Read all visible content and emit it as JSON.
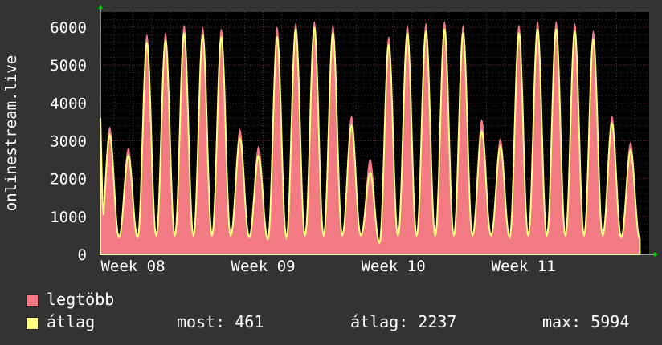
{
  "chart_data": {
    "type": "area",
    "ylabel": "onlinestream.live",
    "ylim": [
      0,
      6400
    ],
    "yticks": [
      0,
      1000,
      2000,
      3000,
      4000,
      5000,
      6000
    ],
    "x_tick_labels": [
      "Week 08",
      "Week 09",
      "Week 10",
      "Week 11"
    ],
    "grid": true,
    "series": [
      {
        "name": "legtöbb",
        "color": "#f27a82",
        "daily_peaks": [
          3350,
          2800,
          5800,
          5850,
          6050,
          6000,
          5950,
          3300,
          2850,
          6000,
          6100,
          6150,
          6050,
          3650,
          2500,
          5750,
          6050,
          6100,
          6150,
          6050,
          3550,
          3050,
          6050,
          6150,
          6150,
          6100,
          5900,
          3650,
          2950
        ],
        "daily_troughs": [
          500,
          500,
          550,
          550,
          550,
          550,
          550,
          500,
          450,
          500,
          550,
          550,
          550,
          550,
          350,
          550,
          550,
          550,
          550,
          550,
          550,
          500,
          550,
          550,
          550,
          550,
          550,
          500,
          450
        ]
      },
      {
        "name": "átlag",
        "color": "#ffff80",
        "daily_peaks": [
          3150,
          2600,
          5600,
          5650,
          5850,
          5800,
          5750,
          3050,
          2600,
          5750,
          5950,
          6000,
          5850,
          3400,
          2150,
          5550,
          5850,
          5900,
          5950,
          5850,
          3250,
          2850,
          5850,
          5950,
          5950,
          5900,
          5700,
          3450,
          2750
        ],
        "daily_troughs": [
          450,
          450,
          500,
          500,
          500,
          500,
          500,
          450,
          400,
          450,
          500,
          500,
          500,
          500,
          300,
          500,
          500,
          500,
          500,
          500,
          500,
          450,
          500,
          500,
          500,
          500,
          500,
          450,
          400
        ]
      }
    ],
    "start_value": 3600
  },
  "legend": {
    "max_label": "legtöbb",
    "avg_label": "átlag",
    "max_color": "#f27a82",
    "avg_color": "#ffff80"
  },
  "stats": {
    "now": "most: 461",
    "avg": "átlag: 2237",
    "max": "max: 5994"
  }
}
